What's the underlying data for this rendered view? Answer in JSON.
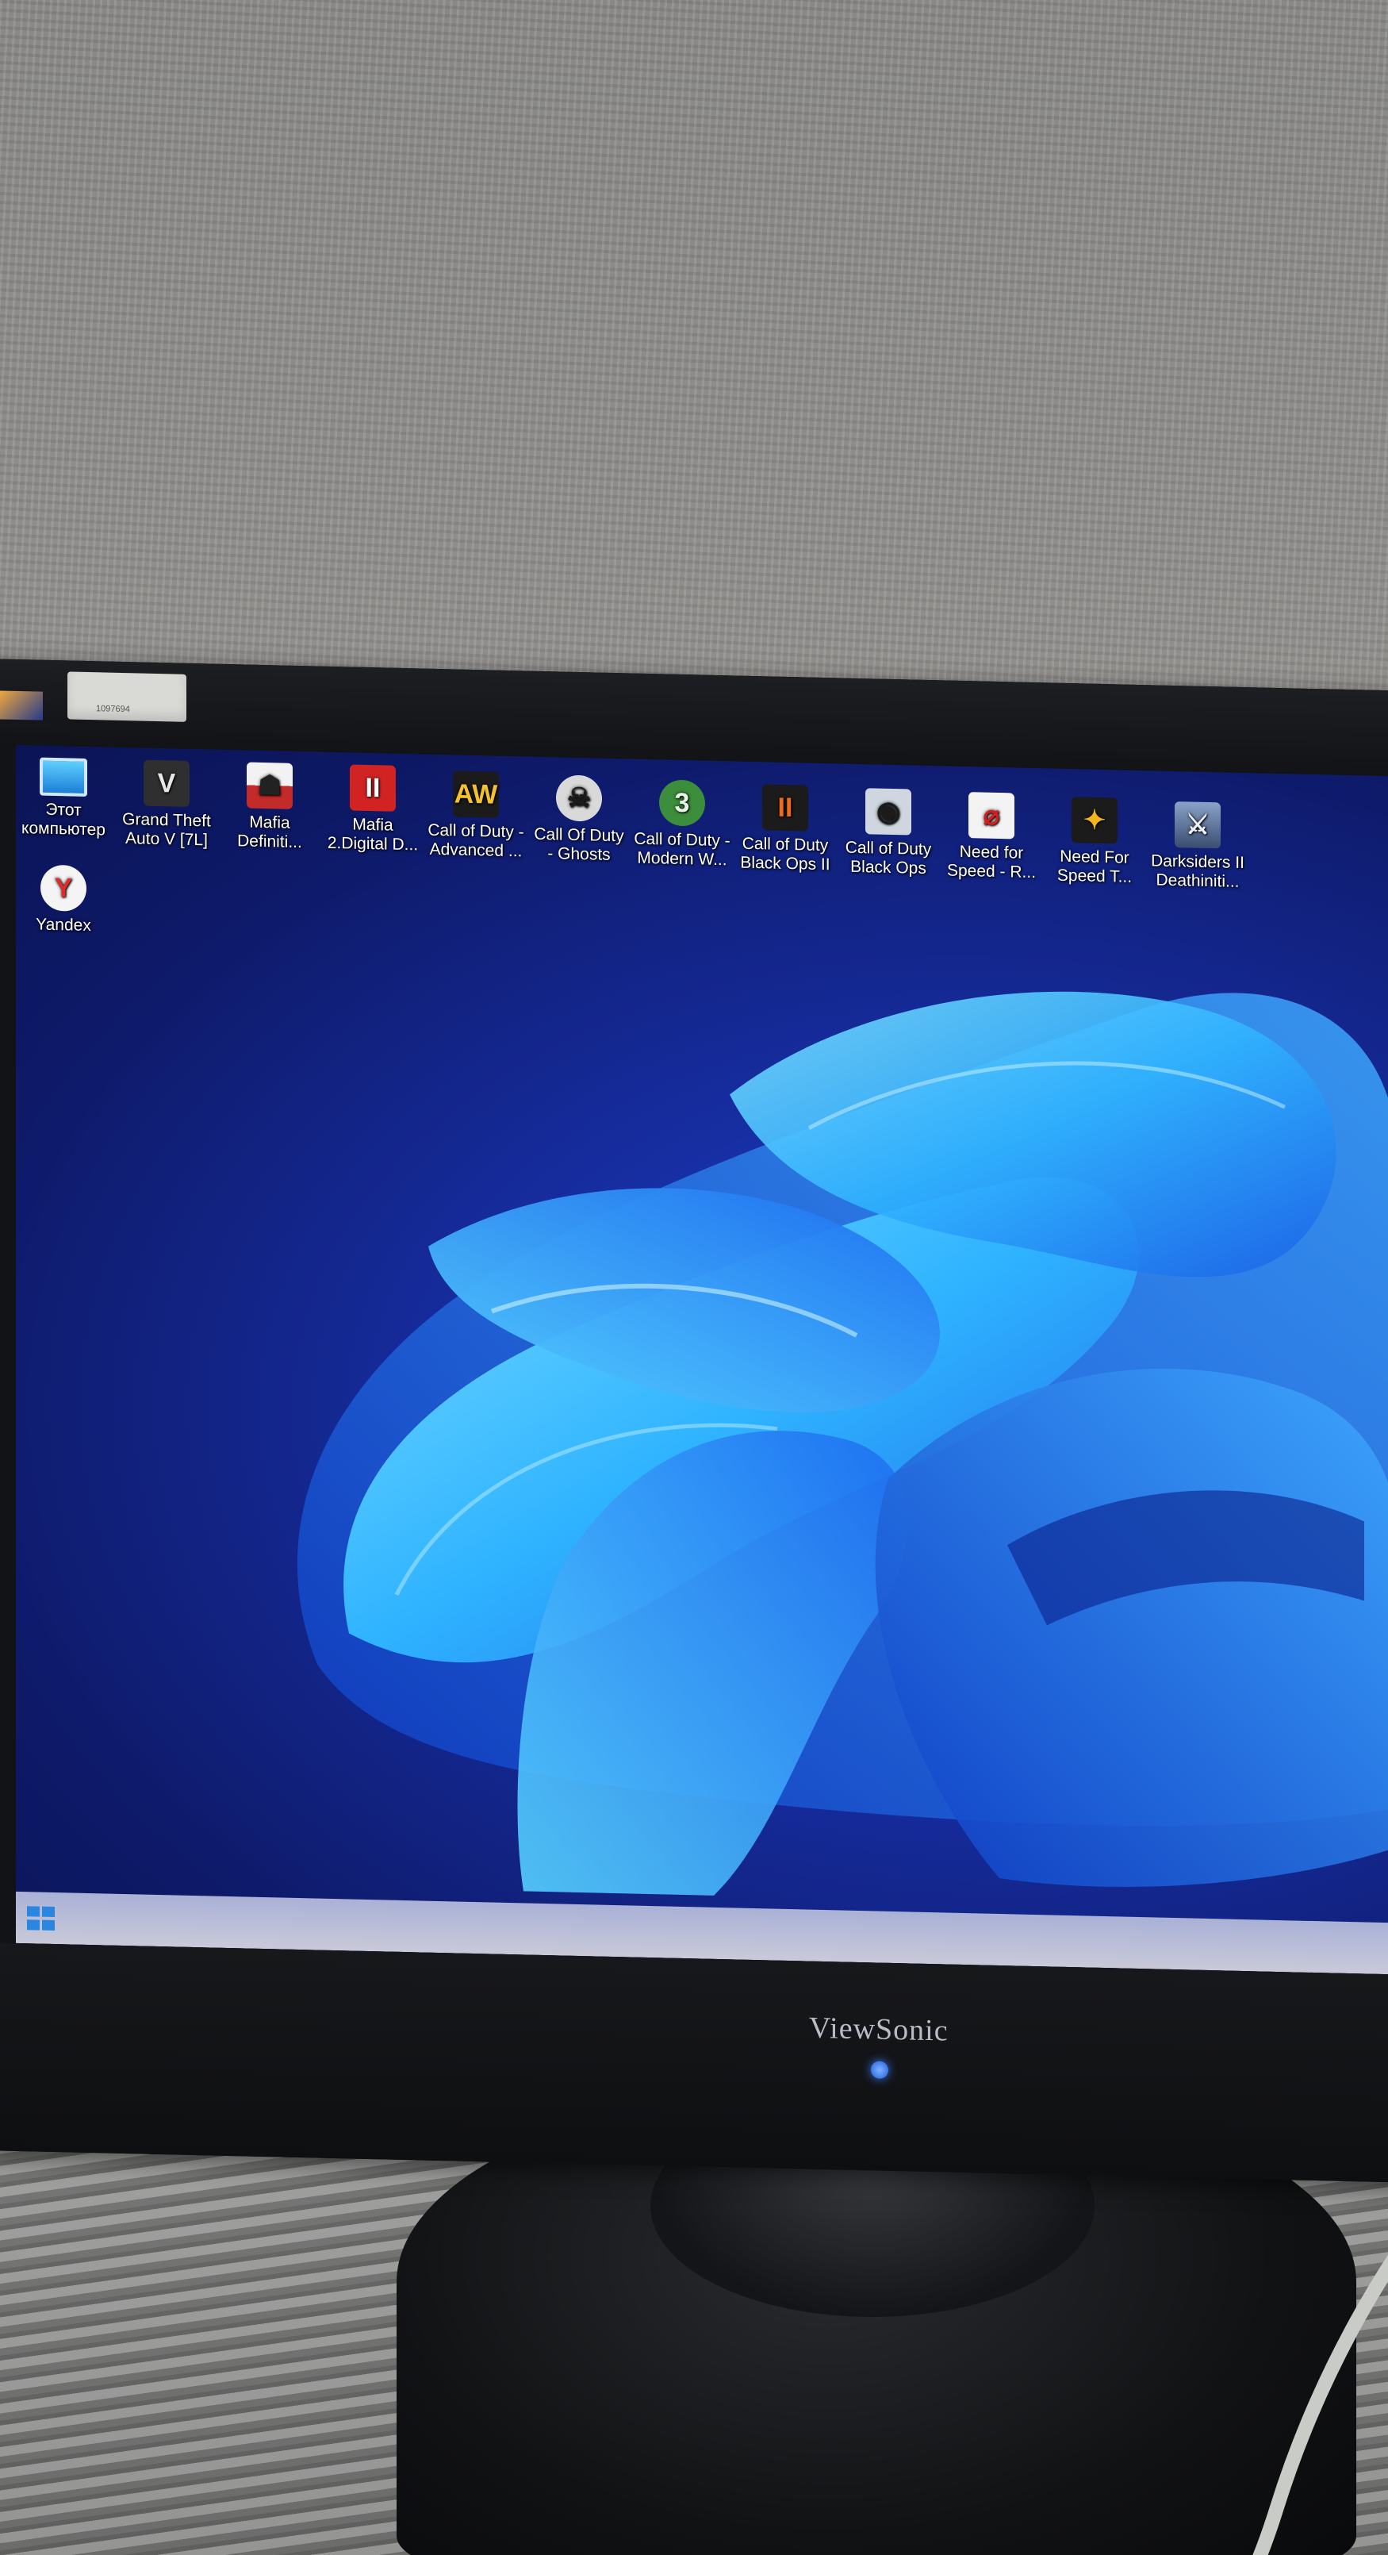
{
  "colors": {
    "wallpaper_bg": "#0e1a6a",
    "bloom_accent": "#2fb3ff",
    "taskbar": "#b7bdd8",
    "start_accent": "#2b86e0"
  },
  "monitor": {
    "sticker_text": "1097694",
    "brand": "ViewSonic"
  },
  "desktop": {
    "icons": [
      {
        "label": "Этот\nкомпьютер",
        "icon": "monitor-icon"
      },
      {
        "label": "Grand Theft\nAuto V [7L]",
        "icon": "gta-v-icon"
      },
      {
        "label": "Mafia\nDefiniti...",
        "icon": "mafia-icon"
      },
      {
        "label": "Mafia\n2.Digital D...",
        "icon": "mafia-2-icon"
      },
      {
        "label": "Call of Duty -\nAdvanced ...",
        "icon": "cod-aw-icon"
      },
      {
        "label": "Call Of Duty\n- Ghosts",
        "icon": "cod-ghosts-icon"
      },
      {
        "label": "Call of Duty -\nModern W...",
        "icon": "cod-mw-icon"
      },
      {
        "label": "Call of Duty\nBlack Ops II",
        "icon": "cod-bo2-icon"
      },
      {
        "label": "Call of Duty\nBlack Ops",
        "icon": "cod-bo-icon"
      },
      {
        "label": "Need for\nSpeed - R...",
        "icon": "nfs-icon"
      },
      {
        "label": "Need For\nSpeed T...",
        "icon": "nfs-t-icon"
      },
      {
        "label": "Darksiders II\nDeathiniti...",
        "icon": "darksiders-icon"
      },
      {
        "label": "Yandex",
        "icon": "yandex-icon"
      }
    ]
  },
  "taskbar": {
    "start_icon": "windows-start-icon"
  }
}
